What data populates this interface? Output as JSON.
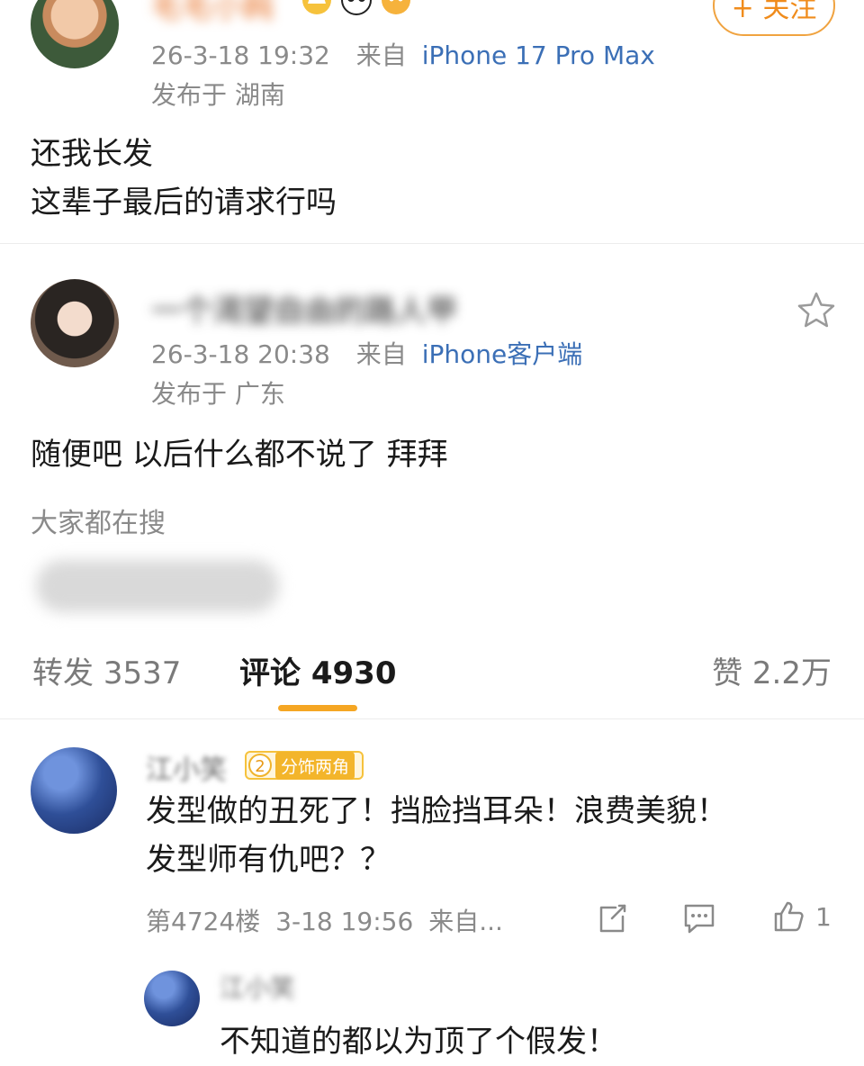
{
  "post_top": {
    "username": "毛毛小飩",
    "badges": [
      "crown-icon",
      "panda-icon",
      "cat-icon"
    ],
    "follow_label": "+ 关注",
    "time": "26-3-18 19:32",
    "source_prefix": "来自",
    "device": "iPhone 17 Pro Max",
    "location": "发布于 湖南",
    "content_lines": [
      "还我长发",
      "这辈子最后的请求行吗"
    ]
  },
  "post_second": {
    "username": "一个渴望自由的路人甲",
    "time": "26-3-18 20:38",
    "source_prefix": "来自",
    "device": "iPhone客户端",
    "location": "发布于 广东",
    "content": "随便吧 以后什么都不说了 拜拜",
    "trending_label": "大家都在搜"
  },
  "tabs": {
    "repost_label": "转发",
    "repost_count": "3537",
    "comment_label": "评论",
    "comment_count": "4930",
    "like_label": "赞",
    "like_count": "2.2万",
    "accent_color": "#f5a623"
  },
  "comment": {
    "username": "江小笑",
    "level": "2",
    "badge_text": "分饰两角",
    "lines": [
      "发型做的丑死了！挡脸挡耳朵！浪费美貌！",
      "发型师有仇吧？？"
    ],
    "floor": "第4724楼",
    "time": "3-18 19:56",
    "source": "来自...",
    "like_count": "1"
  },
  "reply": {
    "username": "江小笑",
    "content": "不知道的都以为顶了个假发！"
  }
}
